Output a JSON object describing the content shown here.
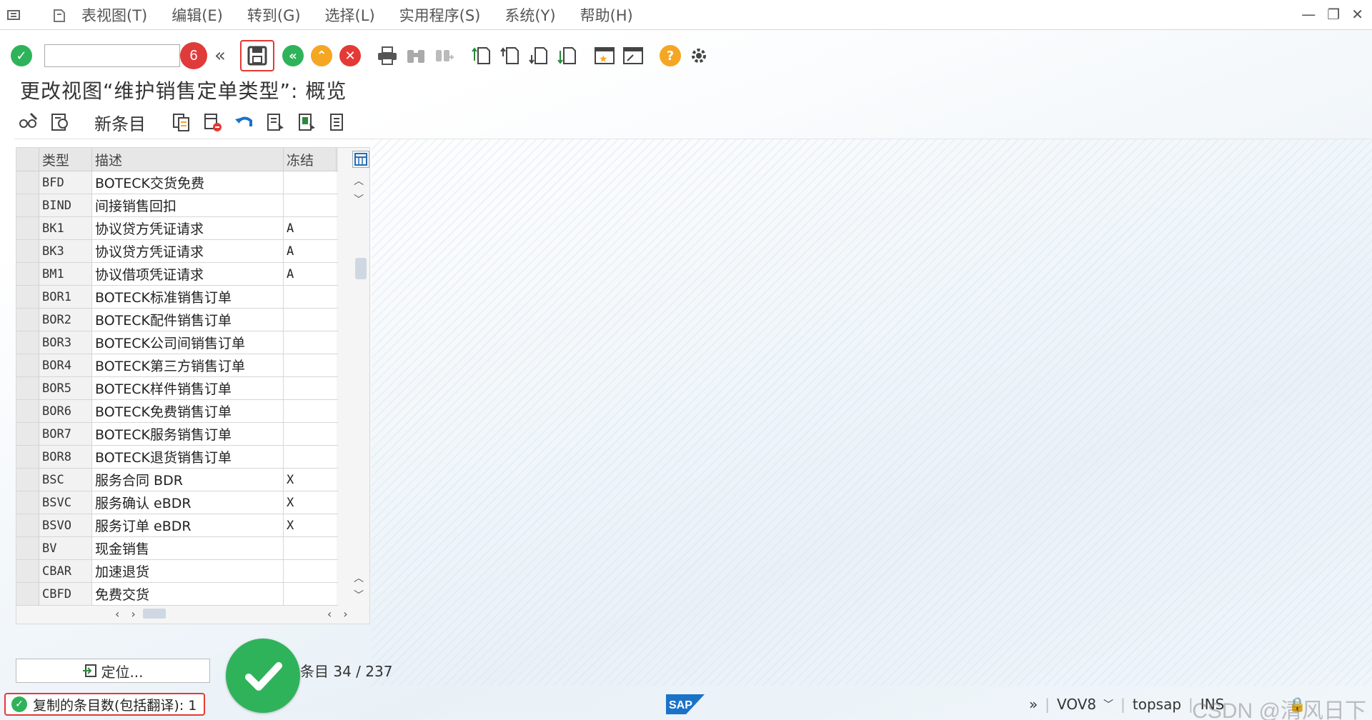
{
  "menu": {
    "items": [
      "表视图(T)",
      "编辑(E)",
      "转到(G)",
      "选择(L)",
      "实用程序(S)",
      "系统(Y)",
      "帮助(H)"
    ]
  },
  "toolbar": {
    "command_value": "",
    "annotation_badge": "6"
  },
  "page": {
    "title": "更改视图“维护销售定单类型”: 概览"
  },
  "actions": {
    "new_entry_label": "新条目"
  },
  "table": {
    "headers": [
      "类型",
      "描述",
      "冻结"
    ],
    "rows": [
      {
        "type": "BFD",
        "desc": "BOTECK交货免费",
        "frozen": ""
      },
      {
        "type": "BIND",
        "desc": "间接销售回扣",
        "frozen": ""
      },
      {
        "type": "BK1",
        "desc": "协议贷方凭证请求",
        "frozen": "A"
      },
      {
        "type": "BK3",
        "desc": "协议贷方凭证请求",
        "frozen": "A"
      },
      {
        "type": "BM1",
        "desc": "协议借项凭证请求",
        "frozen": "A"
      },
      {
        "type": "BOR1",
        "desc": "BOTECK标准销售订单",
        "frozen": ""
      },
      {
        "type": "BOR2",
        "desc": "BOTECK配件销售订单",
        "frozen": ""
      },
      {
        "type": "BOR3",
        "desc": "BOTECK公司间销售订单",
        "frozen": ""
      },
      {
        "type": "BOR4",
        "desc": "BOTECK第三方销售订单",
        "frozen": ""
      },
      {
        "type": "BOR5",
        "desc": "BOTECK样件销售订单",
        "frozen": ""
      },
      {
        "type": "BOR6",
        "desc": "BOTECK免费销售订单",
        "frozen": ""
      },
      {
        "type": "BOR7",
        "desc": "BOTECK服务销售订单",
        "frozen": ""
      },
      {
        "type": "BOR8",
        "desc": "BOTECK退货销售订单",
        "frozen": ""
      },
      {
        "type": "BSC",
        "desc": "服务合同 BDR",
        "frozen": "X"
      },
      {
        "type": "BSVC",
        "desc": "服务确认 eBDR",
        "frozen": "X"
      },
      {
        "type": "BSVO",
        "desc": "服务订单 eBDR",
        "frozen": "X"
      },
      {
        "type": "BV",
        "desc": "现金销售",
        "frozen": ""
      },
      {
        "type": "CBAR",
        "desc": "加速退货",
        "frozen": ""
      },
      {
        "type": "CBFD",
        "desc": "免费交货",
        "frozen": ""
      }
    ]
  },
  "footer": {
    "position_button": "定位...",
    "entry_count": "条目 34 / 237"
  },
  "status": {
    "message": "复制的条目数(包括翻译): 1",
    "transaction": "VOV8",
    "system": "topsap",
    "mode": "INS",
    "watermark": "CSDN @清风日下"
  },
  "colors": {
    "green": "#2fb35a",
    "red": "#e53935",
    "orange": "#f5a623",
    "sap_blue": "#1a73c8"
  }
}
